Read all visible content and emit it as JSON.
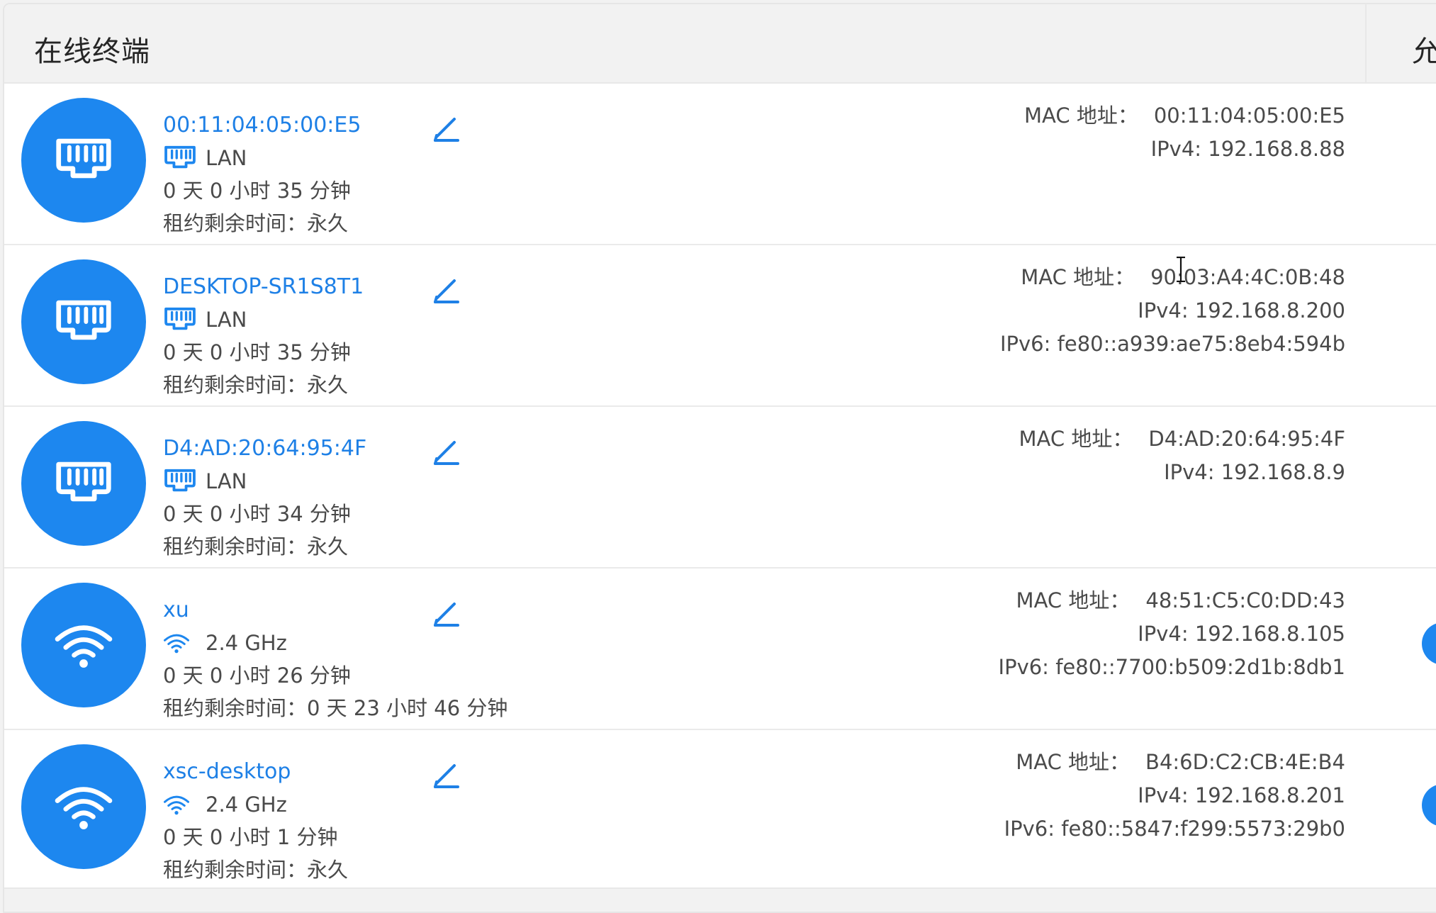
{
  "panel": {
    "title": "在线终端",
    "right_header_partial": "允"
  },
  "devices": [
    {
      "name": "00:11:04:05:00:E5",
      "connection_icon": "ethernet-icon",
      "connection": "LAN",
      "online_time": "0 天 0 小时 35 分钟",
      "lease_label": "租约剩余时间：",
      "lease_value": "永久",
      "mac_label": "MAC 地址：",
      "mac": "00:11:04:05:00:E5",
      "ipv4_label": "IPv4:",
      "ipv4": "192.168.8.88",
      "ipv6_label": "",
      "ipv6": ""
    },
    {
      "name": "DESKTOP-SR1S8T1",
      "connection_icon": "ethernet-icon",
      "connection": "LAN",
      "online_time": "0 天 0 小时 35 分钟",
      "lease_label": "租约剩余时间：",
      "lease_value": "永久",
      "mac_label": "MAC 地址：",
      "mac": "90:03:A4:4C:0B:48",
      "ipv4_label": "IPv4:",
      "ipv4": "192.168.8.200",
      "ipv6_label": "IPv6:",
      "ipv6": "fe80::a939:ae75:8eb4:594b"
    },
    {
      "name": "D4:AD:20:64:95:4F",
      "connection_icon": "ethernet-icon",
      "connection": "LAN",
      "online_time": "0 天 0 小时 34 分钟",
      "lease_label": "租约剩余时间：",
      "lease_value": "永久",
      "mac_label": "MAC 地址：",
      "mac": "D4:AD:20:64:95:4F",
      "ipv4_label": "IPv4:",
      "ipv4": "192.168.8.9",
      "ipv6_label": "",
      "ipv6": ""
    },
    {
      "name": "xu",
      "connection_icon": "wifi-icon",
      "connection": "2.4 GHz",
      "online_time": "0 天 0 小时 26 分钟",
      "lease_label": "租约剩余时间：",
      "lease_value": "0 天 23 小时 46 分钟",
      "mac_label": "MAC 地址：",
      "mac": "48:51:C5:C0:DD:43",
      "ipv4_label": "IPv4:",
      "ipv4": "192.168.8.105",
      "ipv6_label": "IPv6:",
      "ipv6": "fe80::7700:b509:2d1b:8db1"
    },
    {
      "name": "xsc-desktop",
      "connection_icon": "wifi-icon",
      "connection": "2.4 GHz",
      "online_time": "0 天 0 小时 1 分钟",
      "lease_label": "租约剩余时间：",
      "lease_value": "永久",
      "mac_label": "MAC 地址：",
      "mac": "B4:6D:C2:CB:4E:B4",
      "ipv4_label": "IPv4:",
      "ipv4": "192.168.8.201",
      "ipv6_label": "IPv6:",
      "ipv6": "fe80::5847:f299:5573:29b0"
    }
  ],
  "colors": {
    "accent": "#1d87ef",
    "link": "#1e80e6",
    "text": "#4a4a4a",
    "header_bg": "#f2f2f2"
  }
}
